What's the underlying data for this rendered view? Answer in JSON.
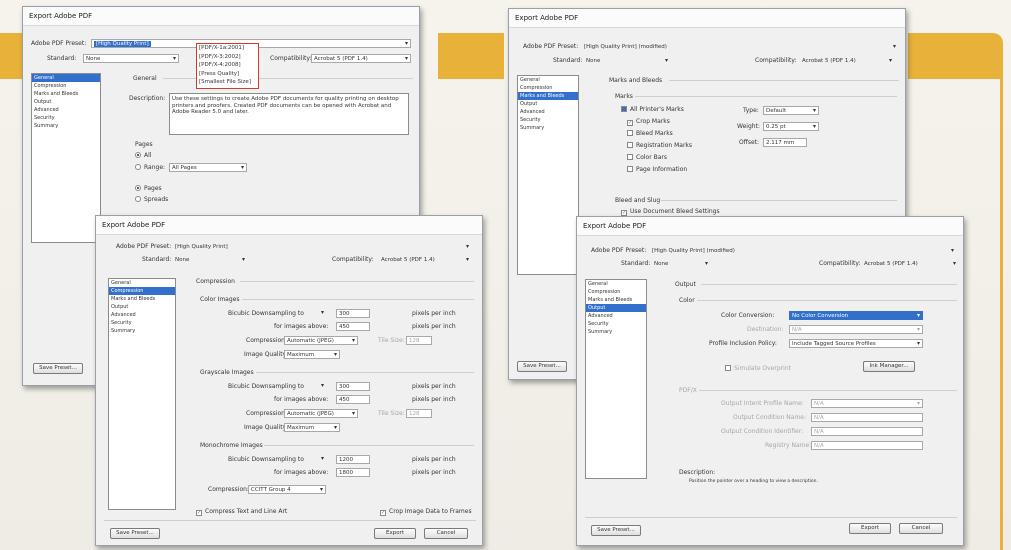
{
  "colors": {
    "accent_band": "#e8b23a",
    "selection": "#3370cc",
    "callout": "#d23a2a"
  },
  "d1": {
    "title": "Export Adobe PDF",
    "preset_label": "Adobe PDF Preset:",
    "preset_value": "[High Quality Print]",
    "standard_label": "Standard:",
    "standard_value": "None",
    "compat_label": "Compatibility:",
    "compat_value": "Acrobat 5 (PDF 1.4)",
    "presets": [
      "[PDF/X-1a:2001]",
      "[PDF/X-3:2002]",
      "[PDF/X-4:2008]",
      "[Press Quality]",
      "[Smallest File Size]"
    ],
    "nav": [
      "General",
      "Compression",
      "Marks and Bleeds",
      "Output",
      "Advanced",
      "Security",
      "Summary"
    ],
    "section": "General",
    "desc_label": "Description:",
    "desc_text": "Use these settings to create Adobe PDF documents for quality printing on desktop printers and proofers. Created PDF documents can be opened with Acrobat and Adobe Reader 5.0 and later.",
    "pages_label": "Pages",
    "all": "All",
    "range": "Range:",
    "range_value": "All Pages",
    "pages_opt": "Pages",
    "spreads": "Spreads",
    "save_preset": "Save Preset..."
  },
  "d2": {
    "title": "Export Adobe PDF",
    "preset_label": "Adobe PDF Preset:",
    "preset_value": "[High Quality Print]",
    "standard_label": "Standard:",
    "standard_value": "None",
    "compat_label": "Compatibility:",
    "compat_value": "Acrobat 5 (PDF 1.4)",
    "nav": [
      "General",
      "Compression",
      "Marks and Bleeds",
      "Output",
      "Advanced",
      "Security",
      "Summary"
    ],
    "section": "Compression",
    "groups": [
      {
        "title": "Color Images",
        "down_label": "Bicubic Downsampling to",
        "down_val": "300",
        "above_label": "for images above:",
        "above_val": "450",
        "unit": "pixels per inch",
        "comp_label": "Compression:",
        "comp_val": "Automatic (JPEG)",
        "tile_label": "Tile Size:",
        "tile_val": "128",
        "qual_label": "Image Quality:",
        "qual_val": "Maximum"
      },
      {
        "title": "Grayscale Images",
        "down_label": "Bicubic Downsampling to",
        "down_val": "300",
        "above_label": "for images above:",
        "above_val": "450",
        "unit": "pixels per inch",
        "comp_label": "Compression:",
        "comp_val": "Automatic (JPEG)",
        "tile_label": "Tile Size:",
        "tile_val": "128",
        "qual_label": "Image Quality:",
        "qual_val": "Maximum"
      }
    ],
    "mono": {
      "title": "Monochrome Images",
      "down_label": "Bicubic Downsampling to",
      "down_val": "1200",
      "above_label": "for images above:",
      "above_val": "1800",
      "unit": "pixels per inch",
      "comp_label": "Compression:",
      "comp_val": "CCITT Group 4"
    },
    "compress_text": "Compress Text and Line Art",
    "crop_data": "Crop Image Data to Frames",
    "save_preset": "Save Preset...",
    "export": "Export",
    "cancel": "Cancel"
  },
  "d3": {
    "title": "Export Adobe PDF",
    "preset_label": "Adobe PDF Preset:",
    "preset_value": "[High Quality Print] (modified)",
    "standard_label": "Standard:",
    "standard_value": "None",
    "compat_label": "Compatibility:",
    "compat_value": "Acrobat 5 (PDF 1.4)",
    "nav": [
      "General",
      "Compression",
      "Marks and Bleeds",
      "Output",
      "Advanced",
      "Security",
      "Summary"
    ],
    "section": "Marks and Bleeds",
    "marks_label": "Marks",
    "all_marks": "All Printer's Marks",
    "marks": [
      "Crop Marks",
      "Bleed Marks",
      "Registration Marks",
      "Color Bars",
      "Page Information"
    ],
    "type_label": "Type:",
    "type_val": "Default",
    "weight_label": "Weight:",
    "weight_val": "0.25 pt",
    "offset_label": "Offset:",
    "offset_val": "2.117 mm",
    "bleed_label": "Bleed and Slug",
    "use_bleed": "Use Document Bleed Settings",
    "save_preset": "Save Preset..."
  },
  "d4": {
    "title": "Export Adobe PDF",
    "preset_label": "Adobe PDF Preset:",
    "preset_value": "[High Quality Print] (modified)",
    "standard_label": "Standard:",
    "standard_value": "None",
    "compat_label": "Compatibility:",
    "compat_value": "Acrobat 5 (PDF 1.4)",
    "nav": [
      "General",
      "Compression",
      "Marks and Bleeds",
      "Output",
      "Advanced",
      "Security",
      "Summary"
    ],
    "section": "Output",
    "color_label": "Color",
    "conv_label": "Color Conversion:",
    "conv_val": "No Color Conversion",
    "dest_label": "Destination:",
    "dest_val": "N/A",
    "incl_label": "Profile Inclusion Policy:",
    "incl_val": "Include Tagged Source Profiles",
    "sim_label": "Simulate Overprint",
    "ink_btn": "Ink Manager...",
    "pdfx_label": "PDF/X",
    "oi_label": "Output Intent Profile Name:",
    "oi_val": "N/A",
    "ocn_label": "Output Condition Name:",
    "ocn_val": "N/A",
    "oci_label": "Output Condition Identifier:",
    "oci_val": "N/A",
    "reg_label": "Registry Name:",
    "reg_val": "N/A",
    "desc_label": "Description:",
    "desc_text": "Position the pointer over a heading to view a description.",
    "save_preset": "Save Preset...",
    "export": "Export",
    "cancel": "Cancel"
  }
}
